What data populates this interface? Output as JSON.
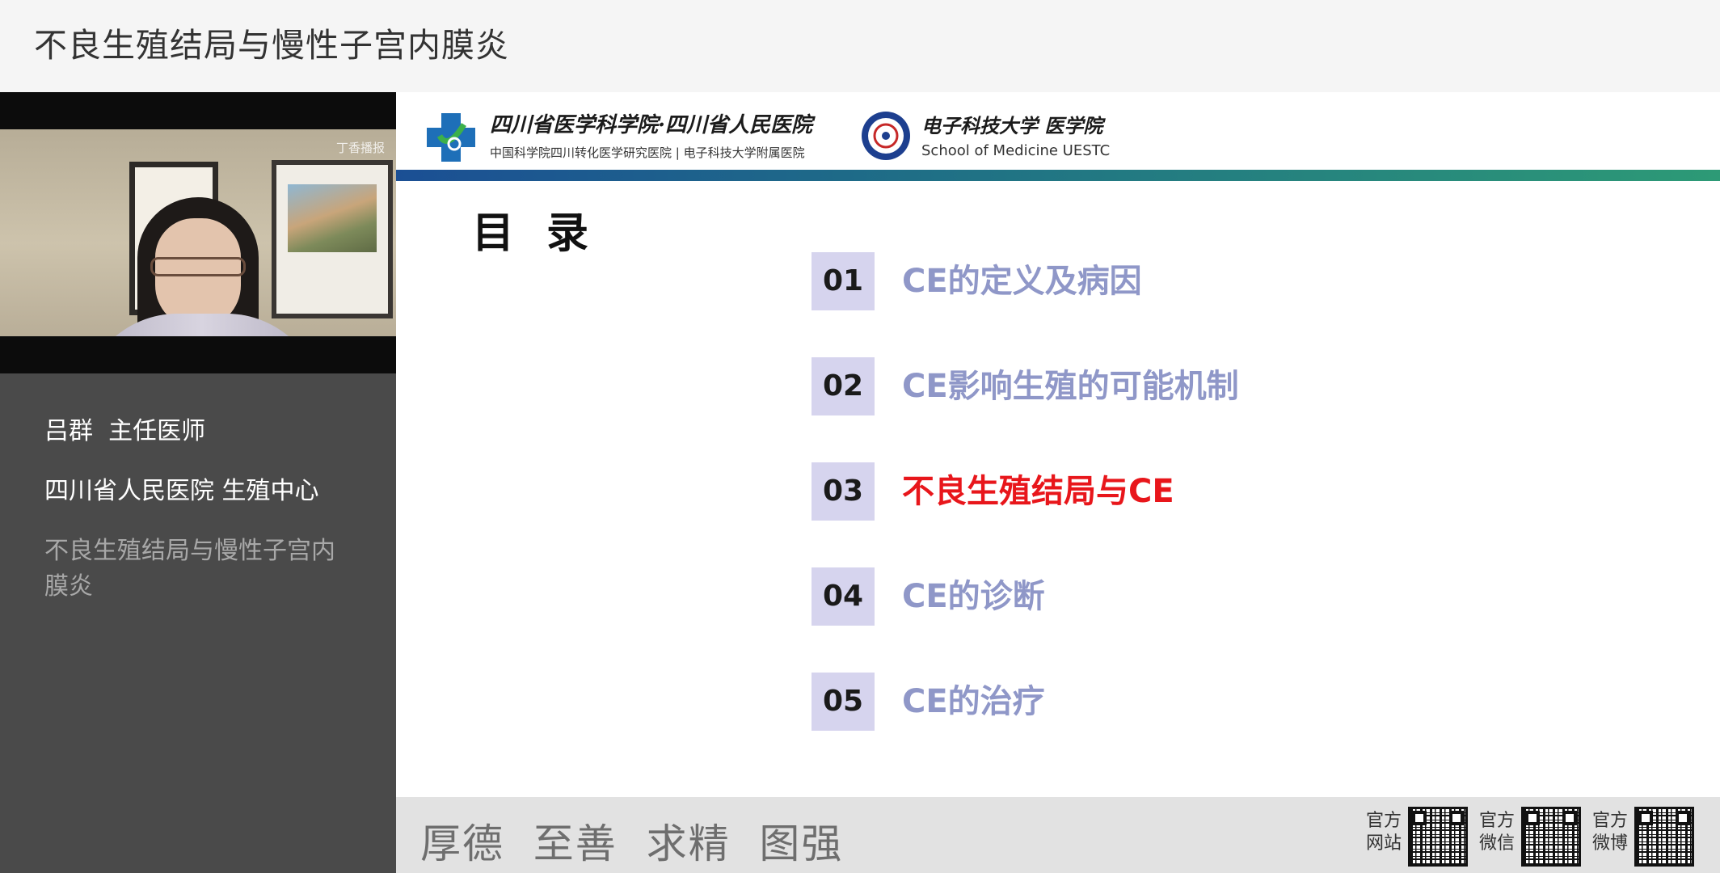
{
  "window": {
    "title": "不良生殖结局与慢性子宫内膜炎"
  },
  "video": {
    "watermark": "丁香播报"
  },
  "presenter": {
    "name": "吕群  主任医师",
    "organization": "四川省人民医院  生殖中心",
    "topic": "不良生殖结局与慢性子宫内膜炎"
  },
  "slide": {
    "logo1": {
      "name_cn": "四川省医学科学院·四川省人民医院",
      "subtitle": "中国科学院四川转化医学研究医院 | 电子科技大学附属医院"
    },
    "logo2": {
      "name_cn": "电子科技大学 医学院",
      "name_en": "School of Medicine UESTC"
    },
    "toc_title": "目录",
    "toc": [
      {
        "num": "01",
        "label": "CE的定义及病因",
        "color": "#8f97c8"
      },
      {
        "num": "02",
        "label": "CE影响生殖的可能机制",
        "color": "#8f97c8"
      },
      {
        "num": "03",
        "label": "不良生殖结局与CE",
        "color": "#e8161b"
      },
      {
        "num": "04",
        "label": "CE的诊断",
        "color": "#8f97c8"
      },
      {
        "num": "05",
        "label": "CE的治疗",
        "color": "#8f97c8"
      }
    ],
    "motto": "厚德  至善  求精  图强",
    "qr": [
      {
        "label": "官方网站"
      },
      {
        "label": "官方微信"
      },
      {
        "label": "官方微博"
      }
    ]
  }
}
